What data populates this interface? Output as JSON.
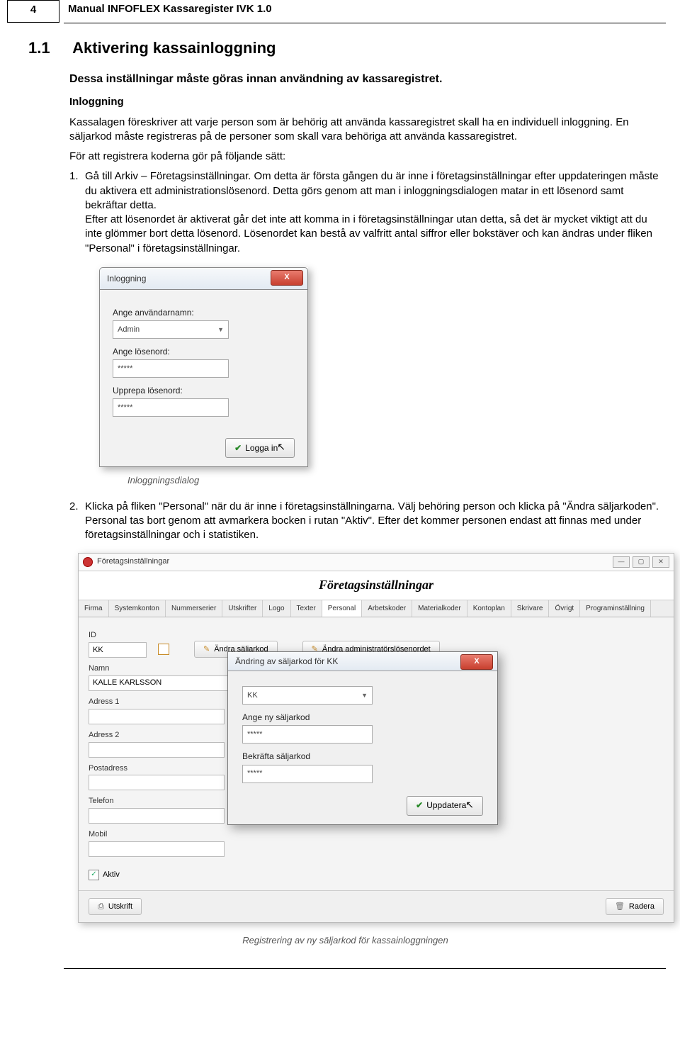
{
  "header": {
    "page_number": "4",
    "manual_title": "Manual INFOFLEX Kassaregister IVK 1.0"
  },
  "section": {
    "num": "1.1",
    "title": "Aktivering kassainloggning"
  },
  "intro": "Dessa inställningar måste göras innan användning av kassaregistret.",
  "sub1_title": "Inloggning",
  "sub1_p": "Kassalagen föreskriver att varje person som är behörig att använda kassaregistret skall ha en individuell inloggning. En säljarkod måste registreras på de personer som skall vara behöriga att använda kassaregistret.",
  "sub1_p2": "För att registrera koderna gör på följande sätt:",
  "steps": {
    "s1": "Gå till Arkiv – Företagsinställningar. Om detta är första gången du är inne i företagsinställningar efter uppdateringen måste du aktivera ett administrationslösenord. Detta görs genom att man i inloggningsdialogen matar in ett lösenord samt bekräftar detta.\nEfter att lösenordet är aktiverat går det inte att komma in i företagsinställningar utan detta, så det är mycket viktigt att du inte glömmer bort detta lösenord. Lösenordet kan bestå av valfritt antal siffror eller bokstäver och kan ändras under fliken \"Personal\" i företagsinställningar.",
    "s2": "Klicka på fliken \"Personal\" när du är inne i företagsinställningarna. Välj behöring person och klicka på \"Ändra säljarkoden\". Personal tas bort genom att avmarkera bocken i rutan \"Aktiv\". Efter det kommer personen endast att finnas med under företagsinställningar och i statistiken."
  },
  "login": {
    "title": "Inloggning",
    "close_x": "X",
    "lbl_user": "Ange användarnamn:",
    "val_user": "Admin",
    "lbl_pass": "Ange lösenord:",
    "val_pass": "*****",
    "lbl_pass2": "Upprepa lösenord:",
    "val_pass2": "*****",
    "btn_login": "Logga in"
  },
  "caption1": "Inloggningsdialog",
  "cs": {
    "win_title": "Företagsinställningar",
    "banner": "Företagsinställningar",
    "min": "—",
    "max": "▢",
    "close": "✕",
    "tabs": [
      "Firma",
      "Systemkonton",
      "Nummerserier",
      "Utskrifter",
      "Logo",
      "Texter",
      "Personal",
      "Arbetskoder",
      "Materialkoder",
      "Kontoplan",
      "Skrivare",
      "Övrigt",
      "Programinställning"
    ],
    "active_tab": "Personal",
    "lbl_id": "ID",
    "val_id": "KK",
    "btn_andra_salj": "Ändra säljarkod",
    "btn_andra_admin": "Ändra administratörslösenordet",
    "lbl_namn": "Namn",
    "val_namn": "KALLE KARLSSON",
    "lbl_a1": "Adress 1",
    "lbl_a2": "Adress 2",
    "lbl_post": "Postadress",
    "lbl_tel": "Telefon",
    "lbl_mob": "Mobil",
    "chk_aktiv": "Aktiv",
    "chk_mark": "✓",
    "btn_utskrift": "Utskrift",
    "btn_radera": "Radera"
  },
  "modal": {
    "title": "Ändring av säljarkod för KK",
    "close_x": "X",
    "val_id": "KK",
    "lbl_new": "Ange ny säljarkod",
    "val_new": "*****",
    "lbl_conf": "Bekräfta säljarkod",
    "val_conf": "*****",
    "btn_upd": "Uppdatera"
  },
  "caption2": "Registrering av ny säljarkod för kassainloggningen"
}
